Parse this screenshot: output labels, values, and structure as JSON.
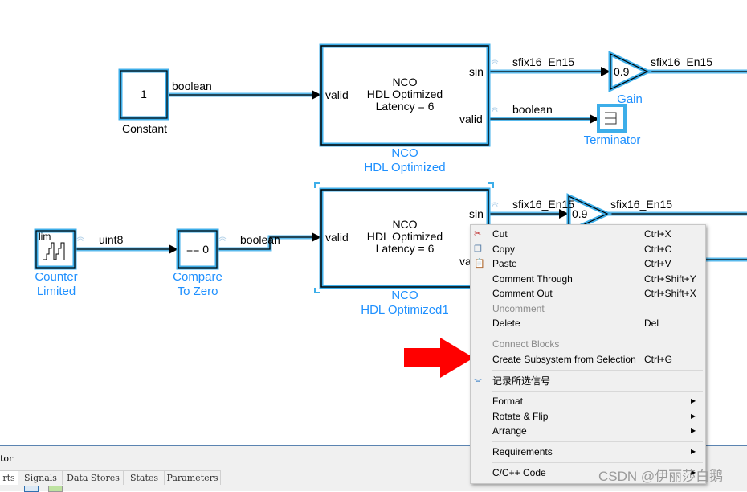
{
  "diagram": {
    "constant": {
      "value": "1",
      "name": "Constant",
      "out_type": "boolean"
    },
    "nco1": {
      "line1": "NCO",
      "line2": "HDL Optimized",
      "line3": "Latency = 6",
      "in_port": "valid",
      "out_port1": "sin",
      "out_port2": "valid",
      "name_line1": "NCO",
      "name_line2": "HDL Optimized",
      "sin_type": "sfix16_En15",
      "valid_type": "boolean"
    },
    "gain1": {
      "value": "0.9",
      "name": "Gain",
      "out_type": "sfix16_En15"
    },
    "terminator": {
      "name": "Terminator"
    },
    "counter": {
      "icon_text": "lim",
      "name_line1": "Counter",
      "name_line2": "Limited",
      "out_type": "uint8"
    },
    "compare": {
      "value": "== 0",
      "name_line1": "Compare",
      "name_line2": "To Zero",
      "out_type": "boolean"
    },
    "nco2": {
      "line1": "NCO",
      "line2": "HDL Optimized",
      "line3": "Latency = 6",
      "in_port": "valid",
      "out_port1": "sin",
      "out_port2": "va",
      "name_line1": "NCO",
      "name_line2": "HDL Optimized1",
      "sin_type": "sfix16_En15"
    },
    "gain2": {
      "value": "0.9",
      "out_type": "sfix16_En15"
    },
    "highlight_color": "#3daee9"
  },
  "context_menu": {
    "items": [
      {
        "label": "Cut",
        "shortcut": "Ctrl+X",
        "icon": "scissors-icon"
      },
      {
        "label": "Copy",
        "shortcut": "Ctrl+C",
        "icon": "copy-icon"
      },
      {
        "label": "Paste",
        "shortcut": "Ctrl+V",
        "icon": "paste-icon"
      },
      {
        "label": "Comment Through",
        "shortcut": "Ctrl+Shift+Y"
      },
      {
        "label": "Comment Out",
        "shortcut": "Ctrl+Shift+X"
      },
      {
        "label": "Uncomment",
        "disabled": true
      },
      {
        "label": "Delete",
        "shortcut": "Del"
      },
      {
        "label": "Connect Blocks",
        "disabled": true
      },
      {
        "label": "Create Subsystem from Selection",
        "shortcut": "Ctrl+G"
      },
      {
        "label": "记录所选信号",
        "icon": "signal-log-icon"
      },
      {
        "label": "Format",
        "submenu": true
      },
      {
        "label": "Rotate & Flip",
        "submenu": true
      },
      {
        "label": "Arrange",
        "submenu": true
      },
      {
        "label": "Requirements",
        "submenu": true
      },
      {
        "label": "C/C++ Code",
        "submenu": true
      }
    ]
  },
  "bottom_panel": {
    "title": "tor",
    "tabs": [
      "rts",
      "Signals",
      "Data Stores",
      "States",
      "Parameters"
    ]
  },
  "watermark": "CSDN @伊丽莎白鹅",
  "arrow_color": "#ff0000"
}
